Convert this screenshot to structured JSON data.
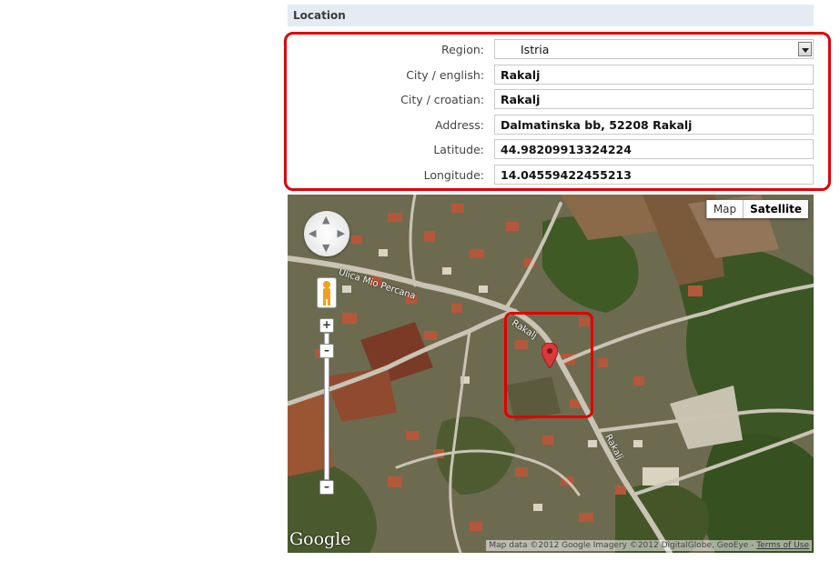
{
  "section": {
    "title": "Location"
  },
  "form": {
    "region": {
      "label": "Region:",
      "value": "Istria"
    },
    "city_english": {
      "label": "City / english:",
      "value": "Rakalj"
    },
    "city_croatian": {
      "label": "City / croatian:",
      "value": "Rakalj"
    },
    "address": {
      "label": "Address:",
      "value": "Dalmatinska bb, 52208 Rakalj"
    },
    "latitude": {
      "label": "Latitude:",
      "value": "44.98209913324224"
    },
    "longitude": {
      "label": "Longitude:",
      "value": "14.04559422455213"
    }
  },
  "map": {
    "type_buttons": {
      "map": "Map",
      "satellite": "Satellite"
    },
    "active_type": "Satellite",
    "street_labels": {
      "ulica_mio": "Ulica Mio Percana",
      "rakalj_1": "Rakalj",
      "rakalj_2": "Rakalj"
    },
    "logo": "Google",
    "attribution": "Map data ©2012 Google Imagery ©2012 DigitalGlobe, GeoEye - ",
    "terms": "Terms of Use",
    "icons": [
      "pan-control-icon",
      "pegman-icon",
      "zoom-in-icon",
      "zoom-out-icon",
      "map-marker-icon"
    ]
  },
  "colors": {
    "highlight": "#e00000",
    "header_bg": "#e4ebf2",
    "marker": "#d9393a"
  }
}
